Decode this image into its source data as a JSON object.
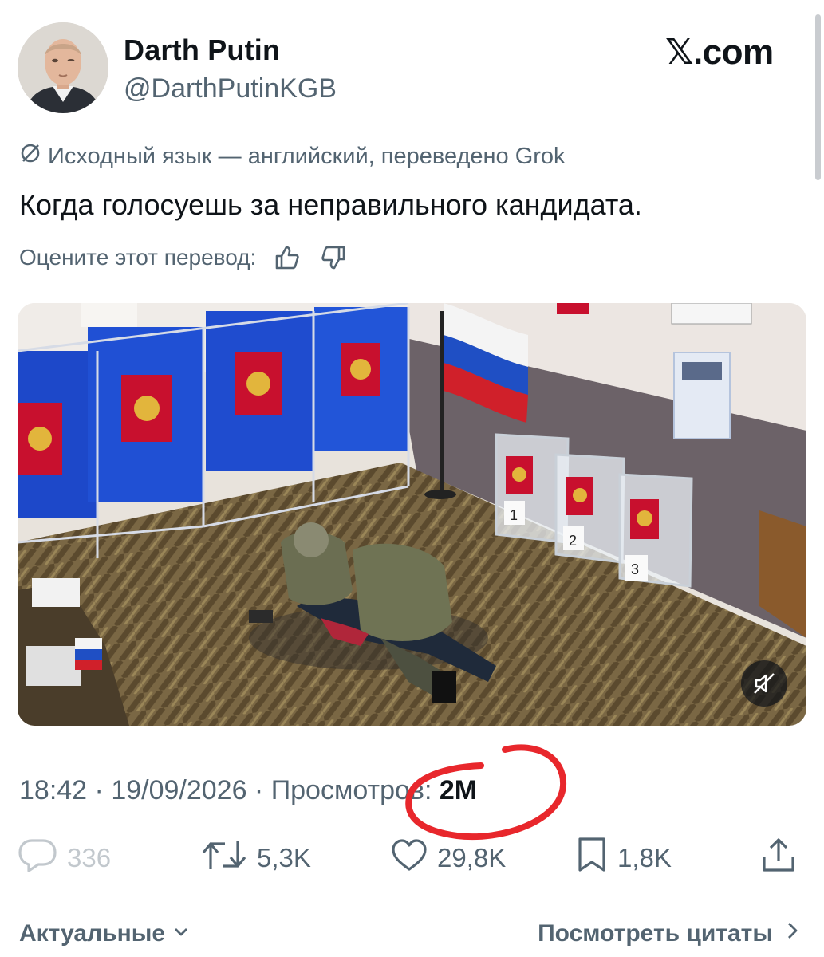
{
  "author": {
    "display_name": "Darth Putin",
    "handle": "@DarthPutinKGB"
  },
  "brand": {
    "logo_text": "𝕏.com"
  },
  "tweet": {
    "translation_note": "Исходный язык — английский, переведено Grok",
    "text": "Когда голосуешь за неправильного кандидата.",
    "rate_prompt": "Оцените этот перевод:"
  },
  "media": {
    "ballot_box_numbers": [
      "1",
      "2",
      "3"
    ],
    "muted": true
  },
  "meta": {
    "time": "18:42",
    "date": "19/09/2026",
    "views_label": "Просмотров:",
    "views_count": "2M",
    "separator": " · "
  },
  "actions": {
    "replies": "336",
    "reposts": "5,3K",
    "likes": "29,8K",
    "bookmarks": "1,8K"
  },
  "footer": {
    "sort_label": "Актуальные",
    "quotes_link": "Посмотреть цитаты"
  },
  "colors": {
    "text_primary": "#0f1419",
    "text_secondary": "#536471",
    "annotation_red": "#e8272c",
    "booth_blue": "#1d48c9",
    "emblem_red": "#c8102e"
  }
}
